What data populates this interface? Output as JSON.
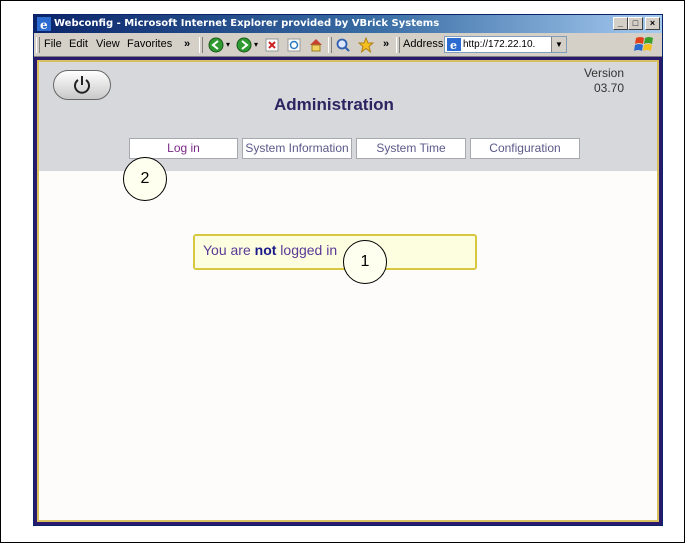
{
  "window": {
    "title": "Webconfig - Microsoft Internet Explorer provided by VBrick Systems",
    "minimize": "_",
    "maximize": "□",
    "close": "×"
  },
  "menu": {
    "file": "File",
    "edit": "Edit",
    "view": "View",
    "favorites": "Favorites",
    "chevron": "»"
  },
  "address": {
    "label": "Address",
    "url": "http://172.22.10."
  },
  "page": {
    "title": "Administration",
    "version_label": "Version",
    "version_number": "03.70",
    "tabs": [
      "Log in",
      "System Information",
      "System Time",
      "Configuration"
    ],
    "message_prefix": "You are ",
    "message_bold": "not",
    "message_suffix": " logged in"
  },
  "callouts": [
    "1",
    "2"
  ],
  "colors": {
    "page_border": "#2a1a6e",
    "gold_frame": "#d8c060",
    "title_color": "#2a2460"
  }
}
